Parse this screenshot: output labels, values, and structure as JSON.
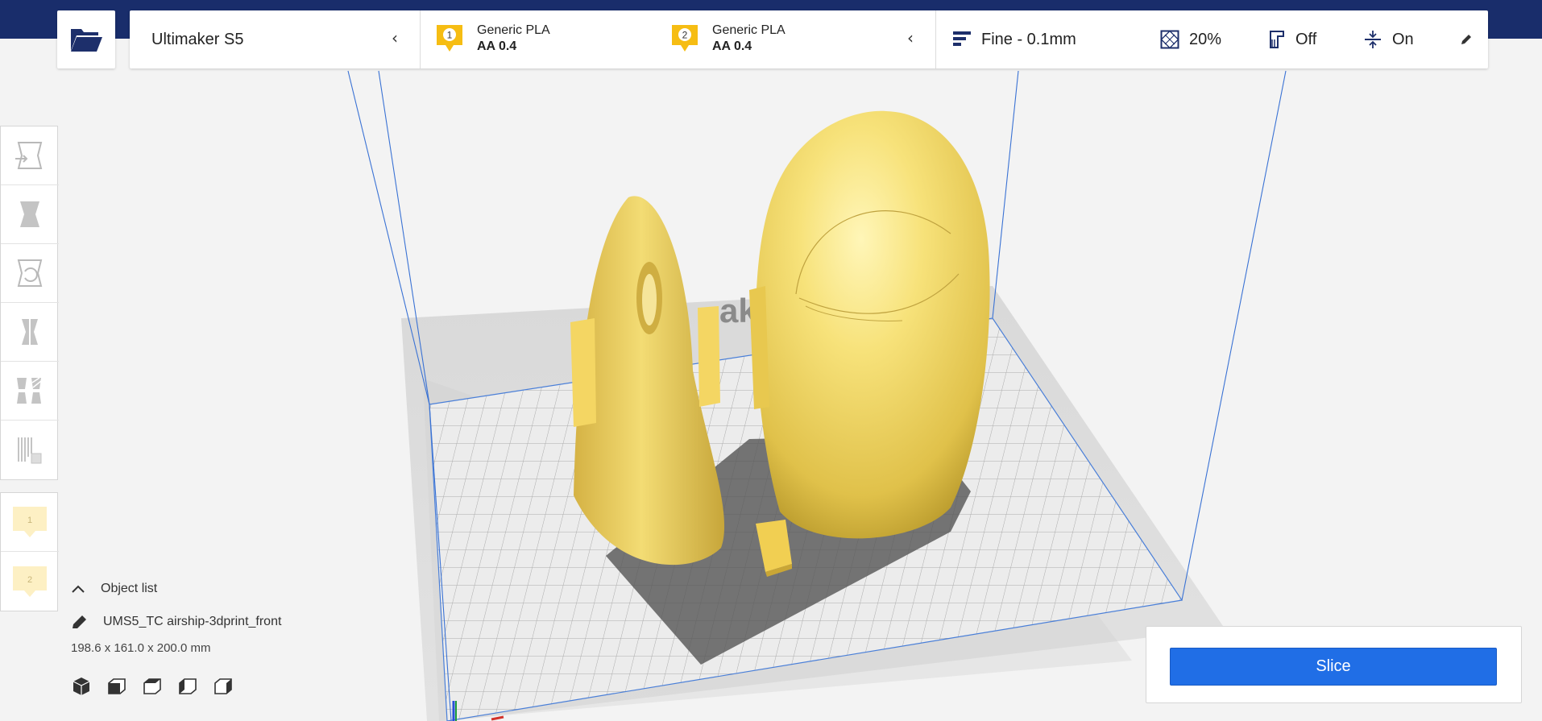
{
  "header": {
    "printer": "Ultimaker S5",
    "extruders": [
      {
        "index": "1",
        "material": "Generic PLA",
        "nozzle": "AA 0.4"
      },
      {
        "index": "2",
        "material": "Generic PLA",
        "nozzle": "AA 0.4"
      }
    ],
    "settings": {
      "profile": "Fine - 0.1mm",
      "infill": "20%",
      "support": "Off",
      "adhesion": "On"
    }
  },
  "extruder_tabs": [
    "1",
    "2"
  ],
  "scene": {
    "bed_logo_text": "ak"
  },
  "object_list": {
    "title": "Object list",
    "object_name": "UMS5_TC airship-3dprint_front",
    "dimensions": "198.6 x 161.0 x 200.0 mm"
  },
  "slice": {
    "label": "Slice"
  },
  "colors": {
    "header_band": "#192d6b",
    "accent_blue": "#206ee6",
    "model_yellow": "#f2d55c",
    "extruder_badge": "#f6bd13"
  }
}
